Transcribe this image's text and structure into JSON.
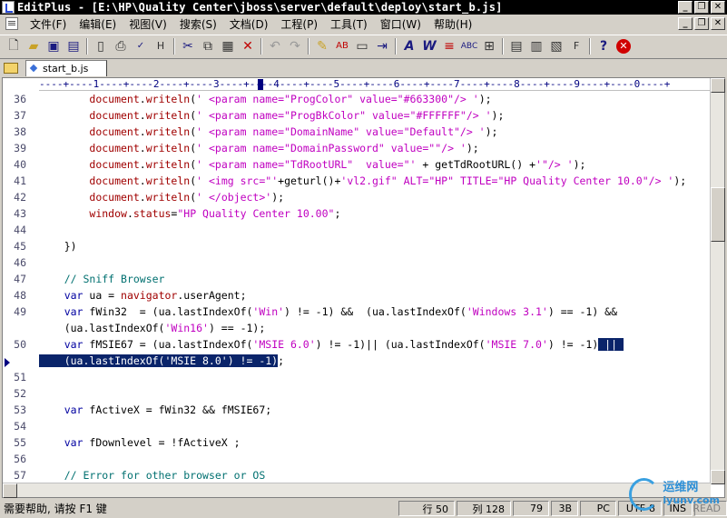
{
  "window": {
    "title": "EditPlus - [E:\\HP\\Quality Center\\jboss\\server\\default\\deploy\\start_b.js]",
    "minimize": "_",
    "maximize": "❐",
    "close": "✕"
  },
  "menu": {
    "items": [
      "文件(F)",
      "编辑(E)",
      "视图(V)",
      "搜索(S)",
      "文档(D)",
      "工程(P)",
      "工具(T)",
      "窗口(W)",
      "帮助(H)"
    ]
  },
  "toolbar": {
    "icons": [
      "new-file",
      "open-file",
      "save",
      "save-all",
      "print-preview",
      "print",
      "spell-check",
      "html-preview",
      "cut",
      "copy",
      "paste",
      "delete",
      "undo",
      "redo",
      "find",
      "replace",
      "clipboard",
      "indent",
      "font",
      "word-wrap",
      "line-number",
      "column-select",
      "ruler",
      "browser-1",
      "browser-2",
      "browser-3",
      "browser-4",
      "help",
      "close-doc"
    ]
  },
  "tabs": {
    "active_file": "start_b.js"
  },
  "editor": {
    "ruler_text": "----+----1----+----2----+----3----+----4----+----5----+----6----+----7----+----8----+----9----+----0----+",
    "lines": [
      {
        "n": "36",
        "segments": [
          [
            "",
            "        "
          ],
          [
            "fn",
            "document"
          ],
          [
            "op",
            "."
          ],
          [
            "fn",
            "writeln"
          ],
          [
            "op",
            "("
          ],
          [
            "str",
            "' <param name=\"ProgColor\" value=\"#663300\"/> '"
          ],
          [
            "op",
            ");"
          ]
        ]
      },
      {
        "n": "37",
        "segments": [
          [
            "",
            "        "
          ],
          [
            "fn",
            "document"
          ],
          [
            "op",
            "."
          ],
          [
            "fn",
            "writeln"
          ],
          [
            "op",
            "("
          ],
          [
            "str",
            "' <param name=\"ProgBkColor\" value=\"#FFFFFF\"/> '"
          ],
          [
            "op",
            ");"
          ]
        ]
      },
      {
        "n": "38",
        "segments": [
          [
            "",
            "        "
          ],
          [
            "fn",
            "document"
          ],
          [
            "op",
            "."
          ],
          [
            "fn",
            "writeln"
          ],
          [
            "op",
            "("
          ],
          [
            "str",
            "' <param name=\"DomainName\" value=\"Default\"/> '"
          ],
          [
            "op",
            ");"
          ]
        ]
      },
      {
        "n": "39",
        "segments": [
          [
            "",
            "        "
          ],
          [
            "fn",
            "document"
          ],
          [
            "op",
            "."
          ],
          [
            "fn",
            "writeln"
          ],
          [
            "op",
            "("
          ],
          [
            "str",
            "' <param name=\"DomainPassword\" value=\"\"/> '"
          ],
          [
            "op",
            ");"
          ]
        ]
      },
      {
        "n": "40",
        "segments": [
          [
            "",
            "        "
          ],
          [
            "fn",
            "document"
          ],
          [
            "op",
            "."
          ],
          [
            "fn",
            "writeln"
          ],
          [
            "op",
            "("
          ],
          [
            "str",
            "' <param name=\"TdRootURL\"  value=\"'"
          ],
          [
            "op",
            " + getTdRootURL() +"
          ],
          [
            "str",
            "'\"/> '"
          ],
          [
            "op",
            ");"
          ]
        ]
      },
      {
        "n": "41",
        "segments": [
          [
            "",
            "        "
          ],
          [
            "fn",
            "document"
          ],
          [
            "op",
            "."
          ],
          [
            "fn",
            "writeln"
          ],
          [
            "op",
            "("
          ],
          [
            "str",
            "' <img src=\"'"
          ],
          [
            "op",
            "+geturl()+"
          ],
          [
            "str",
            "'vl2.gif\" ALT=\"HP\" TITLE=\"HP Quality Center 10.0\"/> '"
          ],
          [
            "op",
            ");"
          ]
        ]
      },
      {
        "n": "42",
        "segments": [
          [
            "",
            "        "
          ],
          [
            "fn",
            "document"
          ],
          [
            "op",
            "."
          ],
          [
            "fn",
            "writeln"
          ],
          [
            "op",
            "("
          ],
          [
            "str",
            "' </object>'"
          ],
          [
            "op",
            ");"
          ]
        ]
      },
      {
        "n": "43",
        "segments": [
          [
            "",
            "        "
          ],
          [
            "fn",
            "window"
          ],
          [
            "op",
            "."
          ],
          [
            "fn",
            "status"
          ],
          [
            "op",
            "="
          ],
          [
            "str",
            "\"HP Quality Center 10.00\""
          ],
          [
            "op",
            ";"
          ]
        ]
      },
      {
        "n": "44",
        "segments": []
      },
      {
        "n": "45",
        "segments": [
          [
            "",
            "    "
          ],
          [
            "op",
            "})"
          ]
        ]
      },
      {
        "n": "46",
        "segments": []
      },
      {
        "n": "47",
        "segments": [
          [
            "",
            "    "
          ],
          [
            "cm",
            "// Sniff Browser"
          ]
        ]
      },
      {
        "n": "48",
        "segments": [
          [
            "",
            "    "
          ],
          [
            "kw",
            "var"
          ],
          [
            "op",
            " ua = "
          ],
          [
            "fn",
            "navigator"
          ],
          [
            "op",
            ".userAgent;"
          ]
        ]
      },
      {
        "n": "49",
        "segments": [
          [
            "",
            "    "
          ],
          [
            "kw",
            "var"
          ],
          [
            "op",
            " fWin32  = (ua.lastIndexOf("
          ],
          [
            "str",
            "'Win'"
          ],
          [
            "op",
            ") != -1) &&  (ua.lastIndexOf("
          ],
          [
            "str",
            "'Windows 3.1'"
          ],
          [
            "op",
            ") == -1) &&"
          ]
        ]
      },
      {
        "n": "",
        "segments": [
          [
            "",
            "    "
          ],
          [
            "op",
            "(ua.lastIndexOf("
          ],
          [
            "str",
            "'Win16'"
          ],
          [
            "op",
            ") == -1);"
          ]
        ]
      },
      {
        "n": "50",
        "segments": [
          [
            "",
            "    "
          ],
          [
            "kw",
            "var"
          ],
          [
            "op",
            " fMSIE67 = (ua.lastIndexOf("
          ],
          [
            "str",
            "'MSIE 6.0'"
          ],
          [
            "op",
            ") != -1)|| (ua.lastIndexOf("
          ],
          [
            "str",
            "'MSIE 7.0'"
          ],
          [
            "op",
            ") != -1)"
          ],
          [
            "sel",
            " || "
          ]
        ]
      },
      {
        "n": "",
        "segments": [
          [
            "sel",
            "    (ua.lastIndexOf('MSIE 8.0') != -1)"
          ],
          [
            "op",
            ";"
          ]
        ]
      },
      {
        "n": "51",
        "segments": []
      },
      {
        "n": "52",
        "segments": []
      },
      {
        "n": "53",
        "segments": [
          [
            "",
            "    "
          ],
          [
            "kw",
            "var"
          ],
          [
            "op",
            " fActiveX = fWin32 && fMSIE67;"
          ]
        ]
      },
      {
        "n": "54",
        "segments": []
      },
      {
        "n": "55",
        "segments": [
          [
            "",
            "    "
          ],
          [
            "kw",
            "var"
          ],
          [
            "op",
            " fDownlevel = !fActiveX ;"
          ]
        ]
      },
      {
        "n": "56",
        "segments": []
      },
      {
        "n": "57",
        "segments": [
          [
            "",
            "    "
          ],
          [
            "cm",
            "// Error for other browser or OS"
          ]
        ]
      }
    ]
  },
  "status": {
    "help": "需要帮助, 请按 F1 键",
    "line": "行 50",
    "col": "列 128",
    "num1": "79",
    "num2": "3B",
    "eol": "PC",
    "encoding": "UTF-8",
    "mode": "INS",
    "read": "READ"
  },
  "watermark": {
    "brand": "运维网",
    "domain": "iyunv.com"
  }
}
